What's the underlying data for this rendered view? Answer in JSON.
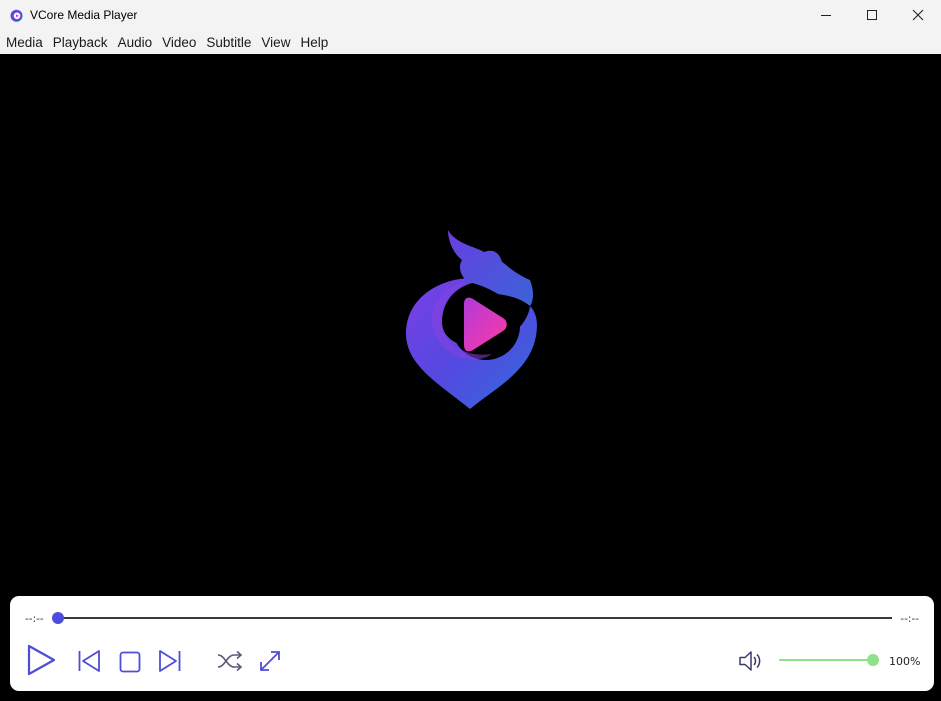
{
  "window": {
    "title": "VCore Media Player",
    "icons": {
      "app": "vcore-logo-icon",
      "minimize": "minimize-icon",
      "maximize": "maximize-icon",
      "close": "close-icon"
    }
  },
  "menu": [
    "Media",
    "Playback",
    "Audio",
    "Video",
    "Subtitle",
    "View",
    "Help"
  ],
  "player": {
    "time_elapsed": "--:--",
    "time_total": "--:--",
    "seek_progress": 0,
    "volume_percent": 100,
    "volume_label": "100%",
    "buttons": {
      "play": "play-icon",
      "previous": "skip-previous-icon",
      "stop": "stop-icon",
      "next": "skip-next-icon",
      "shuffle": "shuffle-icon",
      "fullscreen": "fullscreen-icon",
      "volume": "volume-icon"
    }
  },
  "colors": {
    "accent": "#4e4cd8",
    "volume": "#8fe18a",
    "titlebar": "#f3f3f3",
    "video_bg": "#000000",
    "logo_gradient": [
      "#6a3fe0",
      "#3b5bdc",
      "#e33cc4"
    ]
  }
}
